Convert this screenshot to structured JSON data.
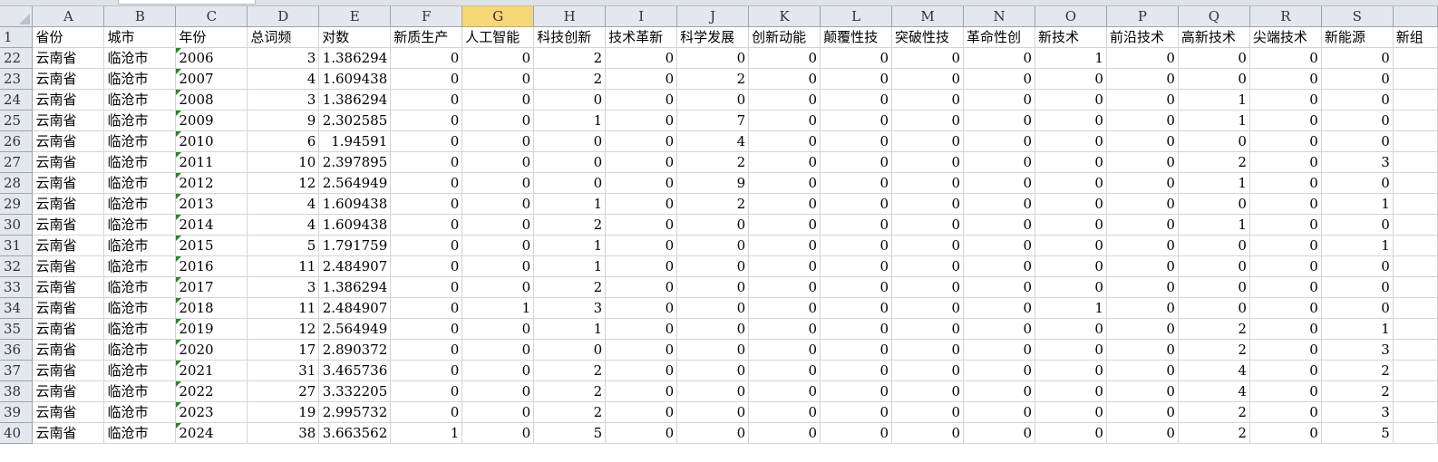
{
  "columns": [
    "A",
    "B",
    "C",
    "D",
    "E",
    "F",
    "G",
    "H",
    "I",
    "J",
    "K",
    "L",
    "M",
    "N",
    "O",
    "P",
    "Q",
    "R",
    "S",
    ""
  ],
  "selected_column": "G",
  "header_row": {
    "row_number": "1",
    "cells": [
      "省份",
      "城市",
      "年份",
      "总词频",
      "对数",
      "新质生产",
      "人工智能",
      "科技创新",
      "技术革新",
      "科学发展",
      "创新动能",
      "颠覆性技",
      "突破性技",
      "革命性创",
      "新技术",
      "前沿技术",
      "高新技术",
      "尖端技术",
      "新能源",
      "新组"
    ]
  },
  "rows": [
    {
      "n": "22",
      "c": [
        "云南省",
        "临沧市",
        "2006",
        "3",
        "1.386294",
        "0",
        "0",
        "2",
        "0",
        "0",
        "0",
        "0",
        "0",
        "0",
        "1",
        "0",
        "0",
        "0",
        "0",
        ""
      ]
    },
    {
      "n": "23",
      "c": [
        "云南省",
        "临沧市",
        "2007",
        "4",
        "1.609438",
        "0",
        "0",
        "2",
        "0",
        "2",
        "0",
        "0",
        "0",
        "0",
        "0",
        "0",
        "0",
        "0",
        "0",
        ""
      ]
    },
    {
      "n": "24",
      "c": [
        "云南省",
        "临沧市",
        "2008",
        "3",
        "1.386294",
        "0",
        "0",
        "0",
        "0",
        "0",
        "0",
        "0",
        "0",
        "0",
        "0",
        "0",
        "1",
        "0",
        "0",
        ""
      ]
    },
    {
      "n": "25",
      "c": [
        "云南省",
        "临沧市",
        "2009",
        "9",
        "2.302585",
        "0",
        "0",
        "1",
        "0",
        "7",
        "0",
        "0",
        "0",
        "0",
        "0",
        "0",
        "1",
        "0",
        "0",
        ""
      ]
    },
    {
      "n": "26",
      "c": [
        "云南省",
        "临沧市",
        "2010",
        "6",
        "1.94591",
        "0",
        "0",
        "0",
        "0",
        "4",
        "0",
        "0",
        "0",
        "0",
        "0",
        "0",
        "0",
        "0",
        "0",
        ""
      ]
    },
    {
      "n": "27",
      "c": [
        "云南省",
        "临沧市",
        "2011",
        "10",
        "2.397895",
        "0",
        "0",
        "0",
        "0",
        "2",
        "0",
        "0",
        "0",
        "0",
        "0",
        "0",
        "2",
        "0",
        "3",
        ""
      ]
    },
    {
      "n": "28",
      "c": [
        "云南省",
        "临沧市",
        "2012",
        "12",
        "2.564949",
        "0",
        "0",
        "0",
        "0",
        "9",
        "0",
        "0",
        "0",
        "0",
        "0",
        "0",
        "1",
        "0",
        "0",
        ""
      ]
    },
    {
      "n": "29",
      "c": [
        "云南省",
        "临沧市",
        "2013",
        "4",
        "1.609438",
        "0",
        "0",
        "1",
        "0",
        "2",
        "0",
        "0",
        "0",
        "0",
        "0",
        "0",
        "0",
        "0",
        "1",
        ""
      ]
    },
    {
      "n": "30",
      "c": [
        "云南省",
        "临沧市",
        "2014",
        "4",
        "1.609438",
        "0",
        "0",
        "2",
        "0",
        "0",
        "0",
        "0",
        "0",
        "0",
        "0",
        "0",
        "1",
        "0",
        "0",
        ""
      ]
    },
    {
      "n": "31",
      "c": [
        "云南省",
        "临沧市",
        "2015",
        "5",
        "1.791759",
        "0",
        "0",
        "1",
        "0",
        "0",
        "0",
        "0",
        "0",
        "0",
        "0",
        "0",
        "0",
        "0",
        "1",
        ""
      ]
    },
    {
      "n": "32",
      "c": [
        "云南省",
        "临沧市",
        "2016",
        "11",
        "2.484907",
        "0",
        "0",
        "1",
        "0",
        "0",
        "0",
        "0",
        "0",
        "0",
        "0",
        "0",
        "0",
        "0",
        "0",
        ""
      ]
    },
    {
      "n": "33",
      "c": [
        "云南省",
        "临沧市",
        "2017",
        "3",
        "1.386294",
        "0",
        "0",
        "2",
        "0",
        "0",
        "0",
        "0",
        "0",
        "0",
        "0",
        "0",
        "0",
        "0",
        "0",
        ""
      ]
    },
    {
      "n": "34",
      "c": [
        "云南省",
        "临沧市",
        "2018",
        "11",
        "2.484907",
        "0",
        "1",
        "3",
        "0",
        "0",
        "0",
        "0",
        "0",
        "0",
        "1",
        "0",
        "0",
        "0",
        "0",
        ""
      ]
    },
    {
      "n": "35",
      "c": [
        "云南省",
        "临沧市",
        "2019",
        "12",
        "2.564949",
        "0",
        "0",
        "1",
        "0",
        "0",
        "0",
        "0",
        "0",
        "0",
        "0",
        "0",
        "2",
        "0",
        "1",
        ""
      ]
    },
    {
      "n": "36",
      "c": [
        "云南省",
        "临沧市",
        "2020",
        "17",
        "2.890372",
        "0",
        "0",
        "0",
        "0",
        "0",
        "0",
        "0",
        "0",
        "0",
        "0",
        "0",
        "2",
        "0",
        "3",
        ""
      ]
    },
    {
      "n": "37",
      "c": [
        "云南省",
        "临沧市",
        "2021",
        "31",
        "3.465736",
        "0",
        "0",
        "2",
        "0",
        "0",
        "0",
        "0",
        "0",
        "0",
        "0",
        "0",
        "4",
        "0",
        "2",
        ""
      ]
    },
    {
      "n": "38",
      "c": [
        "云南省",
        "临沧市",
        "2022",
        "27",
        "3.332205",
        "0",
        "0",
        "2",
        "0",
        "0",
        "0",
        "0",
        "0",
        "0",
        "0",
        "0",
        "4",
        "0",
        "2",
        ""
      ]
    },
    {
      "n": "39",
      "c": [
        "云南省",
        "临沧市",
        "2023",
        "19",
        "2.995732",
        "0",
        "0",
        "2",
        "0",
        "0",
        "0",
        "0",
        "0",
        "0",
        "0",
        "0",
        "2",
        "0",
        "3",
        ""
      ]
    },
    {
      "n": "40",
      "c": [
        "云南省",
        "临沧市",
        "2024",
        "38",
        "3.663562",
        "1",
        "0",
        "5",
        "0",
        "0",
        "0",
        "0",
        "0",
        "0",
        "0",
        "0",
        "2",
        "0",
        "5",
        ""
      ]
    }
  ]
}
